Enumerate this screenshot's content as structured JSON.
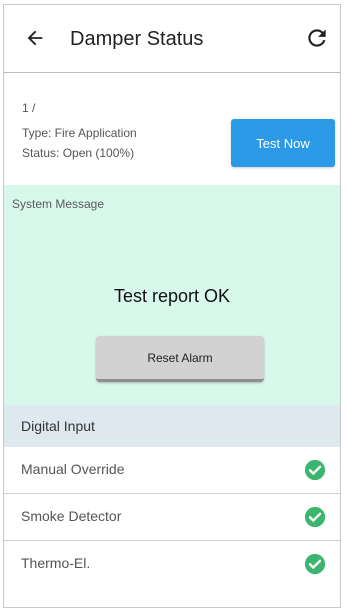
{
  "header": {
    "title": "Damper Status",
    "back_icon": "arrow-left-icon",
    "refresh_icon": "refresh-icon"
  },
  "info": {
    "id": "1 /",
    "type": "Type: Fire Application",
    "status": "Status: Open (100%)",
    "test_button_label": "Test Now"
  },
  "system_message": {
    "header": "System Message",
    "text": "Test report OK",
    "reset_button_label": "Reset Alarm"
  },
  "digital_input": {
    "header": "Digital Input",
    "items": [
      {
        "label": "Manual Override",
        "status_icon": "check-circle-icon"
      },
      {
        "label": "Smoke Detector",
        "status_icon": "check-circle-icon"
      },
      {
        "label": "Thermo-El.",
        "status_icon": "check-circle-icon"
      }
    ]
  },
  "colors": {
    "accent": "#2a9ae6",
    "message_bg": "#d8f8ec",
    "section_header_bg": "#dde8ef",
    "check_green": "#3cb56f"
  }
}
